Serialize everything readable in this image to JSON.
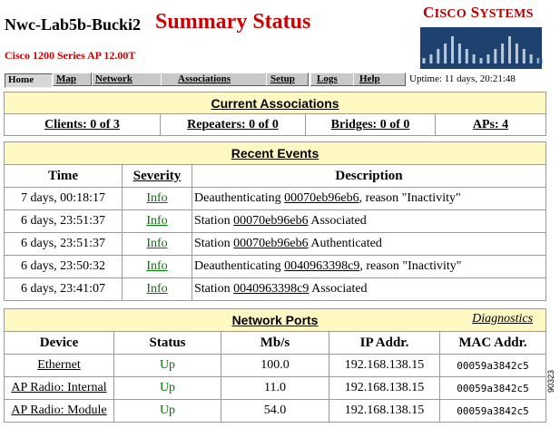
{
  "header": {
    "device_name": "Nwc-Lab5b-Bucki2",
    "page_title": "Summary Status",
    "subtitle": "Cisco 1200 Series AP 12.00T"
  },
  "logo": {
    "text_big_c": "C",
    "text_isco": "ISCO",
    "text_big_s": "S",
    "text_ystems": "YSTEMS",
    "registered": "®",
    "color": "#b50000"
  },
  "nav": {
    "tabs": [
      {
        "label": "Home",
        "active": true
      },
      {
        "label": "Map"
      },
      {
        "label": "Network"
      },
      {
        "label": "Associations"
      },
      {
        "label": "Setup"
      },
      {
        "label": "Logs"
      },
      {
        "label": "Help"
      }
    ],
    "uptime": "Uptime: 11 days, 20:21:48"
  },
  "associations": {
    "title": "Current Associations",
    "clients": "Clients: 0 of 3",
    "repeaters": "Repeaters: 0 of 0",
    "bridges": "Bridges: 0 of 0",
    "aps": "APs: 4"
  },
  "events": {
    "title": "Recent Events",
    "headers": {
      "time": "Time",
      "severity": "Severity",
      "description": "Description"
    },
    "rows": [
      {
        "time": "7 days, 00:18:17",
        "severity": "Info",
        "pre": "Deauthenticating ",
        "mac": "00070eb96eb6",
        "post": ", reason \"Inactivity\""
      },
      {
        "time": "6 days, 23:51:37",
        "severity": "Info",
        "pre": "Station ",
        "mac": "00070eb96eb6",
        "post": " Associated"
      },
      {
        "time": "6 days, 23:51:37",
        "severity": "Info",
        "pre": "Station ",
        "mac": "00070eb96eb6",
        "post": " Authenticated"
      },
      {
        "time": "6 days, 23:50:32",
        "severity": "Info",
        "pre": "Deauthenticating ",
        "mac": "0040963398c9",
        "post": ", reason \"Inactivity\""
      },
      {
        "time": "6 days, 23:41:07",
        "severity": "Info",
        "pre": "Station ",
        "mac": "0040963398c9",
        "post": " Associated"
      }
    ]
  },
  "ports": {
    "title": "Network Ports",
    "diagnostics": "Diagnostics",
    "headers": {
      "device": "Device",
      "status": "Status",
      "mbs": "Mb/s",
      "ip": "IP Addr.",
      "mac": "MAC Addr."
    },
    "rows": [
      {
        "device": "Ethernet",
        "status": "Up",
        "mbs": "100.0",
        "ip": "192.168.138.15",
        "mac": "00059a3842c5"
      },
      {
        "device": "AP Radio: Internal",
        "status": "Up",
        "mbs": "11.0",
        "ip": "192.168.138.15",
        "mac": "00059a3842c5"
      },
      {
        "device": "AP Radio: Module",
        "status": "Up",
        "mbs": "54.0",
        "ip": "192.168.138.15",
        "mac": "00059a3842c5"
      }
    ]
  },
  "figure_id": "90323"
}
